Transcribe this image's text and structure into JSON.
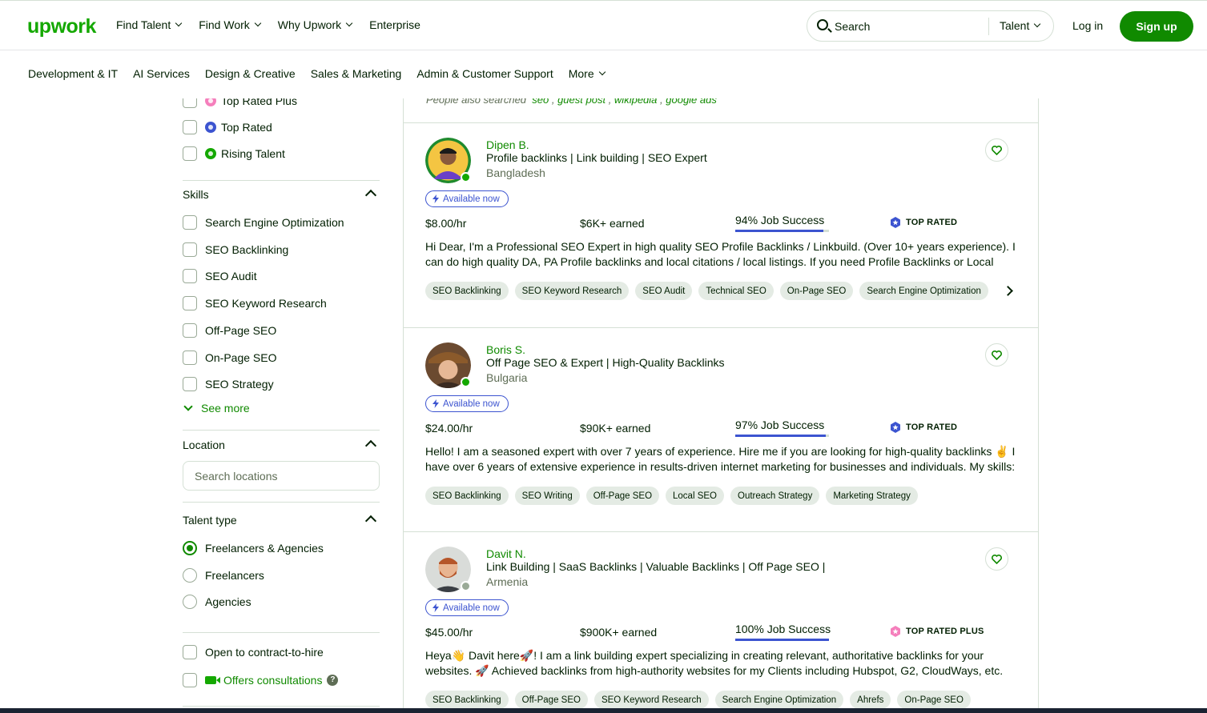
{
  "header": {
    "logo": "upwork",
    "nav": [
      "Find Talent",
      "Find Work",
      "Why Upwork",
      "Enterprise"
    ],
    "search_placeholder": "Search",
    "search_scope": "Talent",
    "login": "Log in",
    "signup": "Sign up"
  },
  "categories": [
    "Development & IT",
    "AI Services",
    "Design & Creative",
    "Sales & Marketing",
    "Admin & Customer Support",
    "More"
  ],
  "sidebar": {
    "badges": [
      "Top Rated Plus",
      "Top Rated",
      "Rising Talent"
    ],
    "skills_title": "Skills",
    "skills": [
      "Search Engine Optimization",
      "SEO Backlinking",
      "SEO Audit",
      "SEO Keyword Research",
      "Off-Page SEO",
      "On-Page SEO",
      "SEO Strategy"
    ],
    "see_more": "See more",
    "location_title": "Location",
    "location_placeholder": "Search locations",
    "talent_type_title": "Talent type",
    "talent_types": [
      "Freelancers & Agencies",
      "Freelancers",
      "Agencies"
    ],
    "contract_to_hire": "Open to contract-to-hire",
    "consultations": "Offers consultations"
  },
  "results": {
    "also_prefix": "People also searched",
    "also_links": [
      "seo",
      "guest post",
      "wikipedia",
      "google ads"
    ],
    "available_label": "Available now",
    "freelancers": [
      {
        "name": "Dipen B.",
        "title": "Profile backlinks | Link building | SEO Expert",
        "country": "Bangladesh",
        "rate": "$8.00/hr",
        "earned": "$6K+ earned",
        "jss": "94% Job Success",
        "jss_value": 94,
        "badge": "TOP RATED",
        "badge_color": "#3c54d0",
        "online": true,
        "description": "Hi Dear, I'm a Professional SEO Expert in high quality SEO Profile Backlinks / Linkbuild. (Over 10+ years experience). I can do high quality DA, PA Profile backlinks and local citations / local listings. If you need Profile Backlinks or Local Citations…",
        "skills": [
          "SEO Backlinking",
          "SEO Keyword Research",
          "SEO Audit",
          "Technical SEO",
          "On-Page SEO",
          "Search Engine Optimization"
        ]
      },
      {
        "name": "Boris S.",
        "title": "Off Page SEO & Expert | High-Quality Backlinks",
        "country": "Bulgaria",
        "rate": "$24.00/hr",
        "earned": "$90K+ earned",
        "jss": "97% Job Success",
        "jss_value": 97,
        "badge": "TOP RATED",
        "badge_color": "#3c54d0",
        "online": true,
        "description": "Hello! I am a seasoned expert with over 7 years of experience. Hire me if you are looking for high-quality backlinks ✌️ I have over 6 years of extensive experience in results-driven internet marketing for businesses and individuals. My skills: I…",
        "skills": [
          "SEO Backlinking",
          "SEO Writing",
          "Off-Page SEO",
          "Local SEO",
          "Outreach Strategy",
          "Marketing Strategy"
        ]
      },
      {
        "name": "Davit N.",
        "title": "Link Building | SaaS Backlinks | Valuable Backlinks | Off Page SEO |",
        "country": "Armenia",
        "rate": "$45.00/hr",
        "earned": "$900K+ earned",
        "jss": "100% Job Success",
        "jss_value": 100,
        "badge": "TOP RATED PLUS",
        "badge_color": "#f57fbc",
        "online": false,
        "description": "Heya👋 Davit here🚀! I am a link building expert specializing in creating relevant, authoritative backlinks for your websites. 🚀 Achieved backlinks from high-authority websites for my Clients including Hubspot, G2, CloudWays, etc. 💯…",
        "skills": [
          "SEO Backlinking",
          "Off-Page SEO",
          "SEO Keyword Research",
          "Search Engine Optimization",
          "Ahrefs",
          "On-Page SEO"
        ]
      }
    ]
  },
  "colors": {
    "brand": "#14a800",
    "button": "#108a00",
    "badge_blue": "#3c54d0",
    "badge_pink": "#f57fbc"
  }
}
